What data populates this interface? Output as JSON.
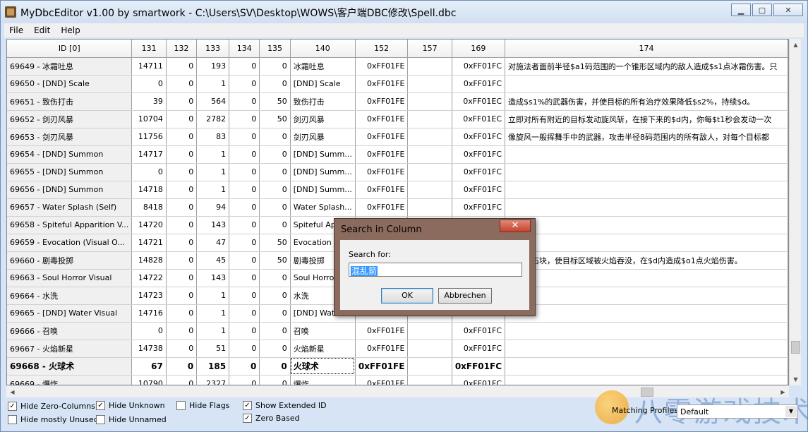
{
  "window": {
    "title": "MyDbcEditor v1.00 by smartwork - C:\\Users\\SV\\Desktop\\WOWS\\客户端DBC修改\\Spell.dbc",
    "minimize": "▁",
    "maximize": "▢",
    "close": "✕"
  },
  "menu": [
    "File",
    "Edit",
    "Help"
  ],
  "grid": {
    "columns": [
      "ID [0]",
      "131",
      "132",
      "133",
      "134",
      "135",
      "140",
      "152",
      "157",
      "169",
      "174"
    ],
    "rows": [
      [
        "69649 - 冰霜吐息",
        "14711",
        "0",
        "193",
        "0",
        "0",
        "冰霜吐息",
        "0xFF01FE",
        "",
        "0xFF01FC",
        "对施法者面前半径$a1码范围的一个锥形区域内的敌人造成$s1点冰霜伤害。只"
      ],
      [
        "69650 - [DND] Scale",
        "0",
        "0",
        "1",
        "0",
        "0",
        "[DND] Scale",
        "0xFF01FE",
        "",
        "0xFF01FC",
        ""
      ],
      [
        "69651 - 致伤打击",
        "39",
        "0",
        "564",
        "0",
        "50",
        "致伤打击",
        "0xFF01FE",
        "",
        "0xFF01EC",
        "造成$s1%的武器伤害，并使目标的所有治疗效果降低$s2%，持续$d。"
      ],
      [
        "69652 - 剑刃风暴",
        "10704",
        "0",
        "2782",
        "0",
        "50",
        "剑刃风暴",
        "0xFF01FE",
        "",
        "0xFF01EC",
        "立即对所有附近的目标发动旋风斩，在接下来的$d内，你每$t1秒会发动一次"
      ],
      [
        "69653 - 剑刃风暴",
        "11756",
        "0",
        "83",
        "0",
        "0",
        "剑刃风暴",
        "0xFF01FE",
        "",
        "0xFF01FC",
        "像旋风一般挥舞手中的武器，攻击半径8码范围内的所有敌人，对每个目标都"
      ],
      [
        "69654 - [DND] Summon",
        "14717",
        "0",
        "1",
        "0",
        "0",
        "[DND] Summ...",
        "0xFF01FE",
        "",
        "0xFF01FC",
        ""
      ],
      [
        "69655 - [DND] Summon",
        "0",
        "0",
        "1",
        "0",
        "0",
        "[DND] Summ...",
        "0xFF01FE",
        "",
        "0xFF01FC",
        ""
      ],
      [
        "69656 - [DND] Summon",
        "14718",
        "0",
        "1",
        "0",
        "0",
        "[DND] Summ...",
        "0xFF01FE",
        "",
        "0xFF01FC",
        ""
      ],
      [
        "69657 - Water Splash (Self)",
        "8418",
        "0",
        "94",
        "0",
        "0",
        "Water Splash...",
        "0xFF01FE",
        "",
        "0xFF01FC",
        ""
      ],
      [
        "69658 - Spiteful Apparition V...",
        "14720",
        "0",
        "143",
        "0",
        "0",
        "Spiteful App",
        "",
        "",
        "",
        ""
      ],
      [
        "69659 - Evocation (Visual O...",
        "14721",
        "0",
        "47",
        "0",
        "50",
        "Evocation (",
        "",
        "",
        "",
        ""
      ],
      [
        "69660 - 剧毒投掷",
        "14828",
        "0",
        "45",
        "0",
        "50",
        "剧毒投掷",
        "",
        "",
        "",
        "燃烧的石块，使目标区域被火焰吞没，在$d内造成$o1点火焰伤害。"
      ],
      [
        "69663 - Soul Horror Visual",
        "14722",
        "0",
        "143",
        "0",
        "0",
        "Soul Horror",
        "",
        "",
        "",
        ""
      ],
      [
        "69664 - 水洗",
        "14723",
        "0",
        "1",
        "0",
        "0",
        "水洗",
        "",
        "",
        "",
        ""
      ],
      [
        "69665 - [DND] Water Visual",
        "14716",
        "0",
        "1",
        "0",
        "0",
        "[DND] Wat",
        "",
        "",
        "",
        ""
      ],
      [
        "69666 - 召唤",
        "0",
        "0",
        "1",
        "0",
        "0",
        "召唤",
        "0xFF01FE",
        "",
        "0xFF01FC",
        ""
      ],
      [
        "69667 - 火焰新星",
        "14738",
        "0",
        "51",
        "0",
        "0",
        "火焰新星",
        "0xFF01FE",
        "",
        "0xFF01FC",
        ""
      ],
      [
        "69668 - 火球术",
        "67",
        "0",
        "185",
        "0",
        "0",
        "火球术",
        "0xFF01FE",
        "",
        "0xFF01FC",
        ""
      ],
      [
        "69669 - 爆炸",
        "10790",
        "0",
        "2327",
        "0",
        "0",
        "爆炸",
        "0xFF01FE",
        "",
        "0xFF01FC",
        ""
      ]
    ],
    "bold_row": 17
  },
  "options": {
    "hide_zero_columns": {
      "label": "Hide Zero-Columns",
      "checked": true
    },
    "hide_mostly_unused": {
      "label": "Hide mostly Unused",
      "checked": false
    },
    "hide_unknown": {
      "label": "Hide Unknown",
      "checked": true
    },
    "hide_unnamed": {
      "label": "Hide Unnamed",
      "checked": false
    },
    "hide_flags": {
      "label": "Hide Flags",
      "checked": false
    },
    "show_extended_id": {
      "label": "Show Extended ID",
      "checked": true
    },
    "zero_based": {
      "label": "Zero Based",
      "checked": true
    }
  },
  "profiles": {
    "label": "Matching Profiles:",
    "value": "Default"
  },
  "watermark": {
    "text": "八零游戏技术"
  },
  "dialog": {
    "title": "Search in Column",
    "close": "✕",
    "label": "Search for:",
    "value": "混乱箭",
    "ok": "OK",
    "cancel": "Abbrechen"
  }
}
